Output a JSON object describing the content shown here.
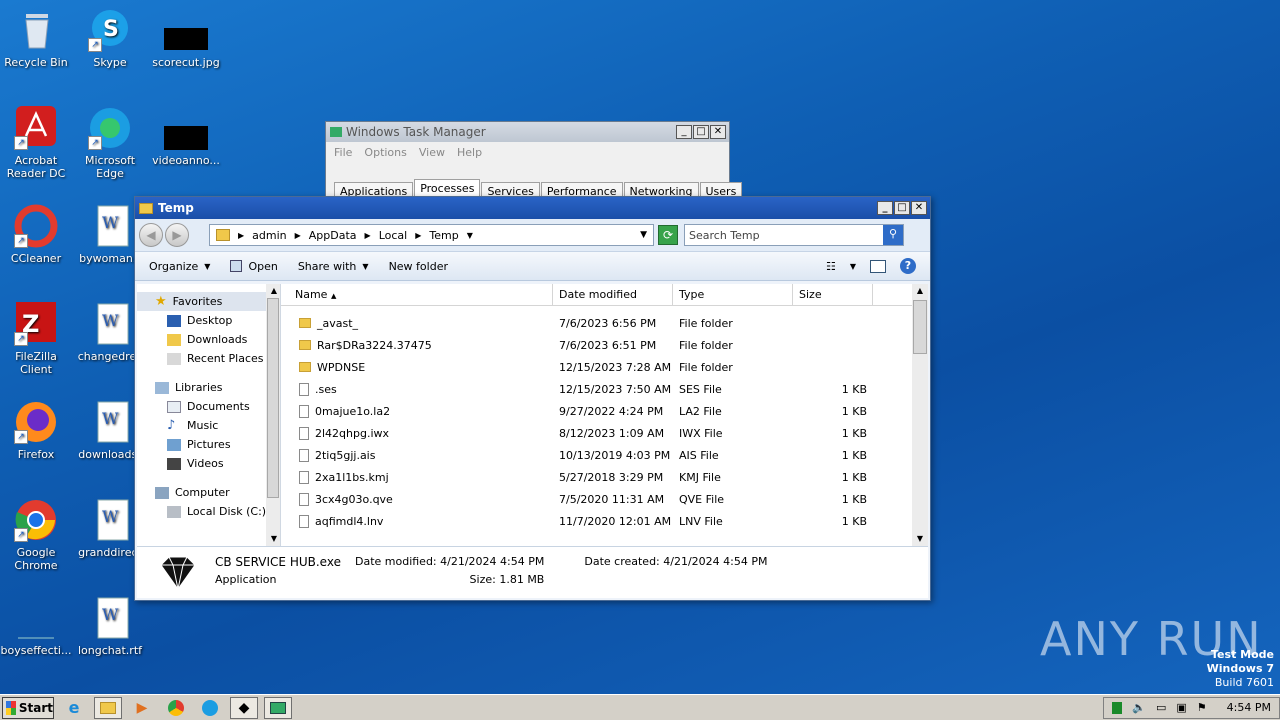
{
  "desktop": {
    "icons": [
      {
        "label": "Recycle Bin"
      },
      {
        "label": "Skype"
      },
      {
        "label": "scorecut.jpg"
      },
      {
        "label": "Acrobat Reader DC"
      },
      {
        "label": "Microsoft Edge"
      },
      {
        "label": "videoanno..."
      },
      {
        "label": "CCleaner"
      },
      {
        "label": "bywoman.r"
      },
      {
        "label": "FileZilla Client"
      },
      {
        "label": "changedrec"
      },
      {
        "label": "Firefox"
      },
      {
        "label": "downloadsr"
      },
      {
        "label": "Google Chrome"
      },
      {
        "label": "granddirect"
      },
      {
        "label": "boyseffecti..."
      },
      {
        "label": "longchat.rtf"
      }
    ]
  },
  "taskmgr": {
    "title": "Windows Task Manager",
    "menu": [
      "File",
      "Options",
      "View",
      "Help"
    ],
    "tabs": [
      "Applications",
      "Processes",
      "Services",
      "Performance",
      "Networking",
      "Users"
    ],
    "active_tab": "Processes"
  },
  "explorer": {
    "title": "Temp",
    "breadcrumb": [
      "admin",
      "AppData",
      "Local",
      "Temp"
    ],
    "search_placeholder": "Search Temp",
    "commands": {
      "organize": "Organize",
      "open": "Open",
      "share": "Share with",
      "new_folder": "New folder"
    },
    "nav": {
      "favorites": "Favorites",
      "desktop": "Desktop",
      "downloads": "Downloads",
      "recent": "Recent Places",
      "libraries": "Libraries",
      "documents": "Documents",
      "music": "Music",
      "pictures": "Pictures",
      "videos": "Videos",
      "computer": "Computer",
      "local_disk": "Local Disk (C:)"
    },
    "columns": {
      "name": "Name",
      "date": "Date modified",
      "type": "Type",
      "size": "Size"
    },
    "files": [
      {
        "name": "_avast_",
        "date": "7/6/2023 6:56 PM",
        "type": "File folder",
        "size": "",
        "folder": true
      },
      {
        "name": "Rar$DRa3224.37475",
        "date": "7/6/2023 6:51 PM",
        "type": "File folder",
        "size": "",
        "folder": true
      },
      {
        "name": "WPDNSE",
        "date": "12/15/2023 7:28 AM",
        "type": "File folder",
        "size": "",
        "folder": true
      },
      {
        "name": ".ses",
        "date": "12/15/2023 7:50 AM",
        "type": "SES File",
        "size": "1 KB",
        "folder": false
      },
      {
        "name": "0majue1o.la2",
        "date": "9/27/2022 4:24 PM",
        "type": "LA2 File",
        "size": "1 KB",
        "folder": false
      },
      {
        "name": "2l42qhpg.iwx",
        "date": "8/12/2023 1:09 AM",
        "type": "IWX File",
        "size": "1 KB",
        "folder": false
      },
      {
        "name": "2tiq5gjj.ais",
        "date": "10/13/2019 4:03 PM",
        "type": "AIS File",
        "size": "1 KB",
        "folder": false
      },
      {
        "name": "2xa1l1bs.kmj",
        "date": "5/27/2018 3:29 PM",
        "type": "KMJ File",
        "size": "1 KB",
        "folder": false
      },
      {
        "name": "3cx4g03o.qve",
        "date": "7/5/2020 11:31 AM",
        "type": "QVE File",
        "size": "1 KB",
        "folder": false
      },
      {
        "name": "aqfimdl4.lnv",
        "date": "11/7/2020 12:01 AM",
        "type": "LNV File",
        "size": "1 KB",
        "folder": false
      }
    ],
    "details": {
      "name": "CB SERVICE HUB.exe",
      "kind": "Application",
      "modified": "Date modified: 4/21/2024 4:54 PM",
      "size": "Size: 1.81 MB",
      "created": "Date created: 4/21/2024 4:54 PM"
    }
  },
  "taskbar": {
    "start": "Start",
    "clock": "4:54 PM"
  },
  "watermark": {
    "line1": "Test Mode",
    "line2": "Windows 7",
    "line3": "Build 7601",
    "brand": "ANY RUN"
  }
}
